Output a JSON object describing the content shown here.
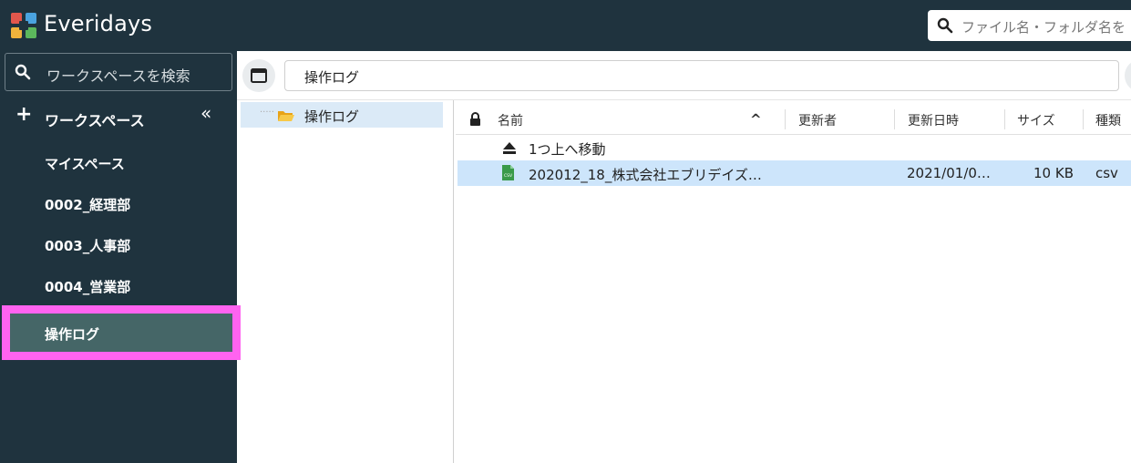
{
  "app": {
    "brand": "Everidays"
  },
  "global_search": {
    "placeholder": "ファイル名・フォルダ名を"
  },
  "sidebar": {
    "search_placeholder": "ワークスペースを検索",
    "workspace_header": "ワークスペース",
    "plus_glyph": "+",
    "collapse_glyph": "«",
    "items": [
      {
        "label": "マイスペース"
      },
      {
        "label": "0002_経理部"
      },
      {
        "label": "0003_人事部"
      },
      {
        "label": "0004_営業部"
      },
      {
        "label": "操作ログ",
        "active": true
      }
    ]
  },
  "pathbar": {
    "path": "操作ログ"
  },
  "tree": {
    "dots": "·····",
    "node_label": "操作ログ"
  },
  "file_list": {
    "columns": {
      "name": "名前",
      "sort_glyph": "^",
      "updated_by": "更新者",
      "updated_at": "更新日時",
      "size": "サイズ",
      "type": "種類"
    },
    "up_row": {
      "label": "1つ上へ移動"
    },
    "rows": [
      {
        "name": "202012_18_株式会社エブリデイズ…",
        "updated_by": "",
        "updated_at": "2021/01/0…",
        "size": "10 KB",
        "type": "csv",
        "selected": true
      }
    ]
  },
  "colors": {
    "sidebar_bg": "#1f333e",
    "active_item_bg": "#456667",
    "highlight": "#ff63f0",
    "selection_bg": "#cde5fb",
    "csv_icon": "#3a9a4a"
  }
}
